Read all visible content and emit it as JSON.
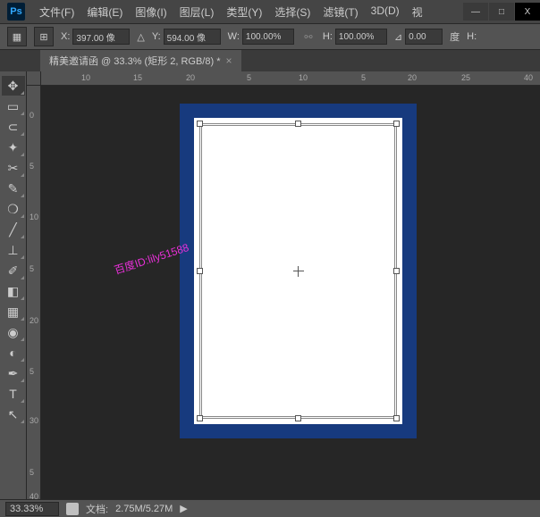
{
  "app": {
    "logo": "Ps"
  },
  "menu": [
    "文件(F)",
    "编辑(E)",
    "图像(I)",
    "图层(L)",
    "类型(Y)",
    "选择(S)",
    "滤镜(T)",
    "3D(D)",
    "视"
  ],
  "window": {
    "min": "—",
    "max": "□",
    "close": "X"
  },
  "options": {
    "x_label": "X:",
    "x_value": "397.00 像",
    "y_label": "Y:",
    "594.00 像": "594.00 像",
    "y_value": "594.00 像",
    "w_label": "W:",
    "w_value": "100.00%",
    "h_label": "H:",
    "h_value": "100.00%",
    "angle_label": "⊿",
    "angle_value": "0.00",
    "deg_label": "度",
    "h2_label": "H:"
  },
  "tab": {
    "title": "精美邀请函 @ 33.3% (矩形 2, RGB/8) *",
    "close": "×"
  },
  "rulers": {
    "h": [
      {
        "v": "10",
        "p": 45
      },
      {
        "v": "15",
        "p": 103
      },
      {
        "v": "20",
        "p": 162
      },
      {
        "v": "5",
        "p": 230
      },
      {
        "v": "10",
        "p": 288
      },
      {
        "v": "5",
        "p": 358
      },
      {
        "v": "20",
        "p": 410
      },
      {
        "v": "25",
        "p": 470
      },
      {
        "v": "40",
        "p": 540
      }
    ],
    "v": [
      {
        "v": "0",
        "p": 28
      },
      {
        "v": "5",
        "p": 85
      },
      {
        "v": "10",
        "p": 142
      },
      {
        "v": "5",
        "p": 200
      },
      {
        "v": "20",
        "p": 258
      },
      {
        "v": "5",
        "p": 315
      },
      {
        "v": "30",
        "p": 370
      },
      {
        "v": "5",
        "p": 428
      },
      {
        "v": "40",
        "p": 455
      }
    ]
  },
  "watermark": "百度ID:lily51588",
  "status": {
    "zoom": "33.33%",
    "doc_label": "文档:",
    "doc_value": "2.75M/5.27M",
    "arrow": "▶"
  }
}
